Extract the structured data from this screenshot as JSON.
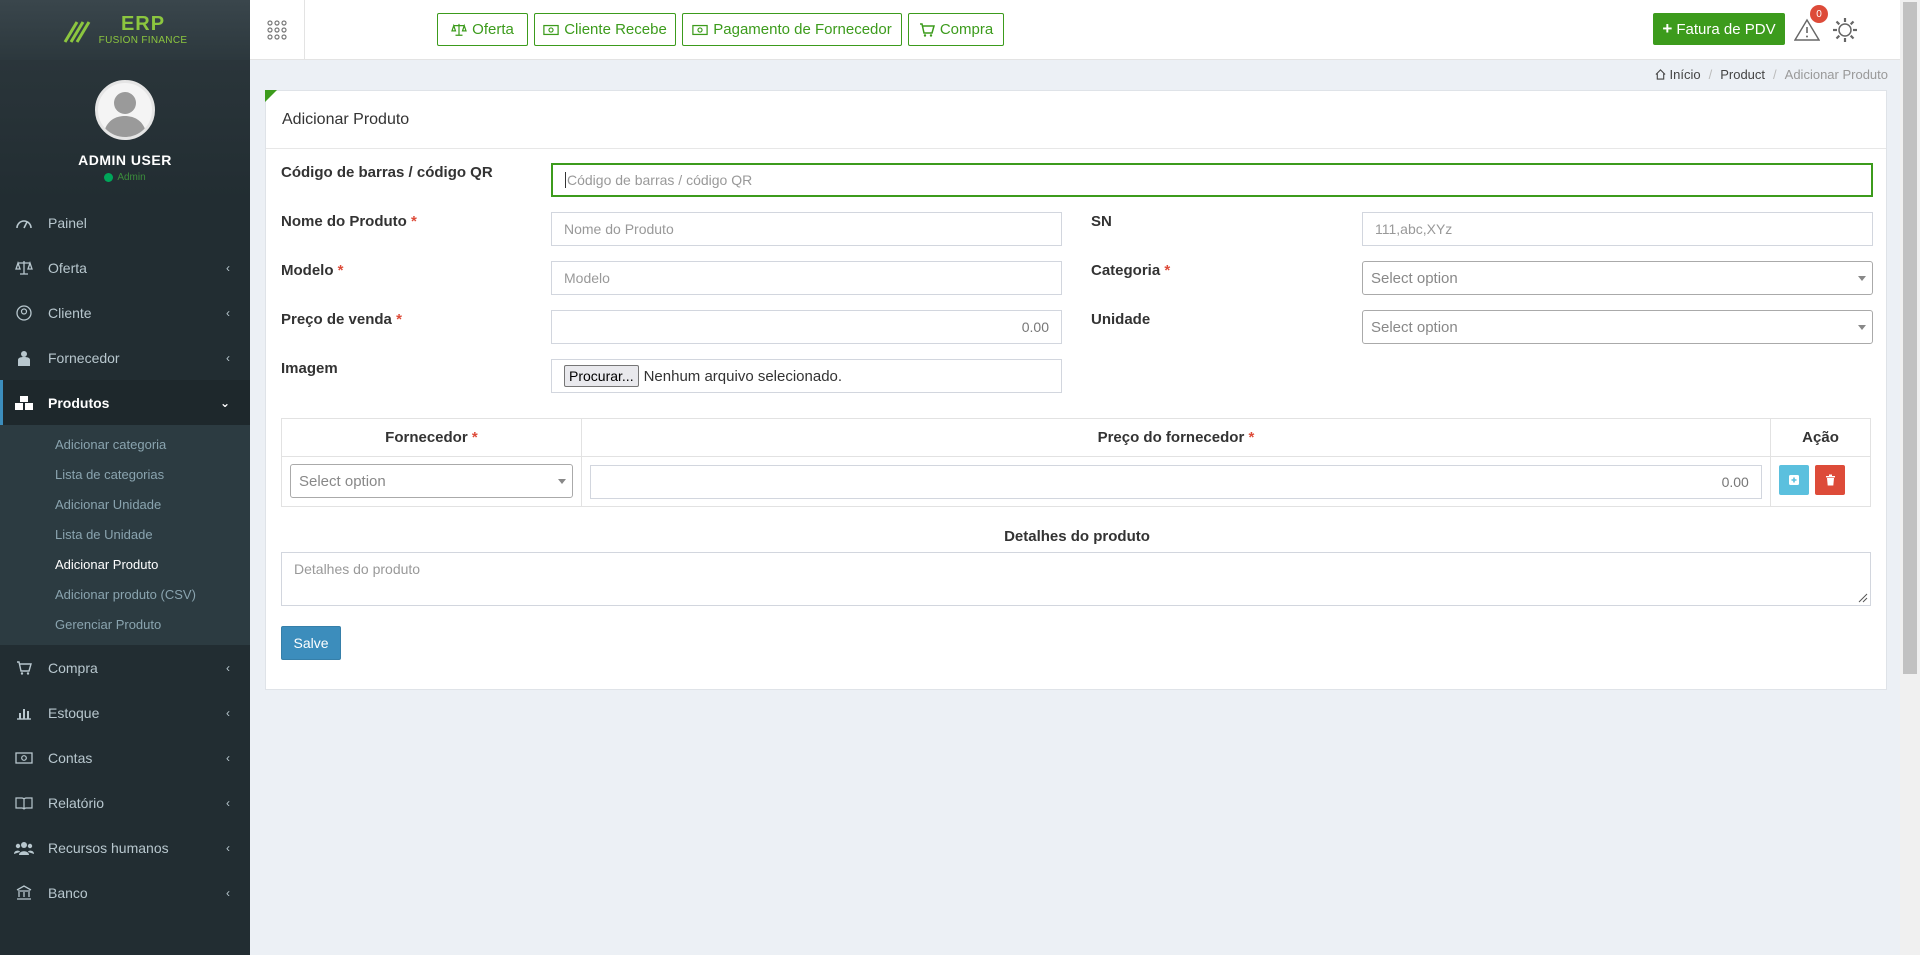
{
  "app": {
    "logo_line1": "ERP",
    "logo_line2": "FUSION FINANCE"
  },
  "user": {
    "name": "ADMIN USER",
    "role": "Admin"
  },
  "sidebar": {
    "items": [
      {
        "label": "Painel",
        "icon": "dashboard-icon"
      },
      {
        "label": "Oferta",
        "icon": "scale-icon"
      },
      {
        "label": "Cliente",
        "icon": "user-circle-icon"
      },
      {
        "label": "Fornecedor",
        "icon": "supplier-icon"
      },
      {
        "label": "Produtos",
        "icon": "cubes-icon"
      },
      {
        "label": "Compra",
        "icon": "cart-icon"
      },
      {
        "label": "Estoque",
        "icon": "bar-chart-icon"
      },
      {
        "label": "Contas",
        "icon": "money-icon"
      },
      {
        "label": "Relatório",
        "icon": "book-icon"
      },
      {
        "label": "Recursos humanos",
        "icon": "users-icon"
      },
      {
        "label": "Banco",
        "icon": "bank-icon"
      }
    ],
    "submenu": [
      "Adicionar categoria",
      "Lista de categorias",
      "Adicionar Unidade",
      "Lista de Unidade",
      "Adicionar Produto",
      "Adicionar produto (CSV)",
      "Gerenciar Produto"
    ]
  },
  "topbar": {
    "quick": [
      "Oferta",
      "Cliente Recebe",
      "Pagamento de Fornecedor",
      "Compra"
    ],
    "pos_label": "Fatura de PDV",
    "alert_count": "0"
  },
  "breadcrumb": {
    "home": "Início",
    "section": "Product",
    "current": "Adicionar Produto"
  },
  "form": {
    "title": "Adicionar Produto",
    "barcode_label": "Código de barras / código QR",
    "barcode_placeholder": "Código de barras / código QR",
    "name_label": "Nome do Produto",
    "name_placeholder": "Nome do Produto",
    "sn_label": "SN",
    "sn_placeholder": "111,abc,XYz",
    "model_label": "Modelo",
    "model_placeholder": "Modelo",
    "category_label": "Categoria",
    "category_value": "Select option",
    "price_label": "Preço de venda",
    "price_value": "0.00",
    "unit_label": "Unidade",
    "unit_value": "Select option",
    "image_label": "Imagem",
    "file_button": "Procurar...",
    "file_status": "Nenhum arquivo selecionado.",
    "required_mark": "*",
    "supplier_table": {
      "col_supplier": "Fornecedor",
      "col_price": "Preço do fornecedor",
      "col_action": "Ação",
      "supplier_value": "Select option",
      "price_value": "0.00"
    },
    "details_label": "Detalhes do produto",
    "details_placeholder": "Detalhes do produto",
    "save_label": "Salve"
  },
  "colors": {
    "brand_green": "#3c9b1c",
    "sidebar_bg": "#222d32",
    "primary_blue": "#3c8dbc",
    "info_cyan": "#5bc0de",
    "danger_red": "#dd4b39"
  }
}
